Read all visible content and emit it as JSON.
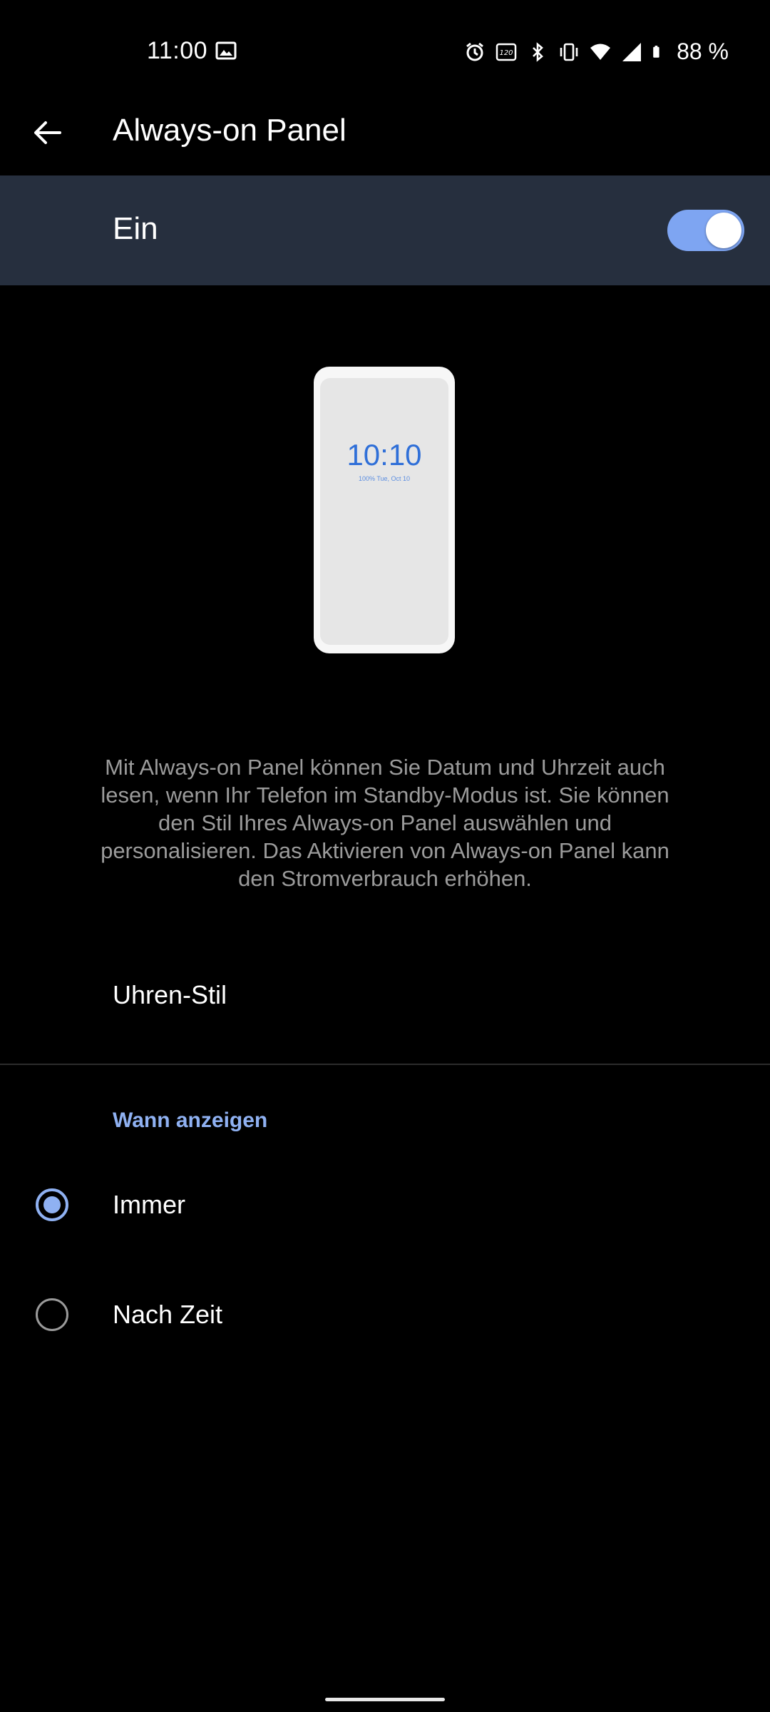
{
  "status_bar": {
    "time": "11:00",
    "battery": "88 %",
    "icons": [
      "image-icon",
      "alarm-icon",
      "refresh-rate-120hz-icon",
      "bluetooth-icon",
      "vibrate-icon",
      "wifi-icon",
      "signal-icon",
      "battery-icon"
    ]
  },
  "app_bar": {
    "title": "Always-on Panel",
    "back_icon": "arrow-back-icon"
  },
  "master_switch": {
    "label": "Ein",
    "state": "on",
    "color": "#7ea5f2"
  },
  "preview": {
    "clock": "10:10",
    "date_line": "100%  Tue, Oct 10"
  },
  "description": "Mit Always-on Panel können Sie Datum und Uhrzeit auch lesen, wenn Ihr Telefon im Standby-Modus ist. Sie können den Stil Ihres Always-on Panel auswählen und personalisieren. Das Aktivieren von Always-on Panel kann den Stromverbrauch erhöhen.",
  "clock_style": {
    "label": "Uhren-Stil"
  },
  "when_show": {
    "header": "Wann anzeigen",
    "options": [
      {
        "label": "Immer",
        "selected": true
      },
      {
        "label": "Nach Zeit",
        "selected": false
      }
    ],
    "accent": "#8fb1f2"
  }
}
